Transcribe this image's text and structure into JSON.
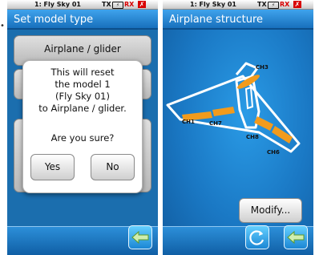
{
  "status": {
    "model": "1: Fly Sky 01",
    "tx_label": "TX",
    "rx_label": "RX"
  },
  "screen1": {
    "title": "Set model type",
    "list_item_1": "Airplane / glider",
    "dialog": {
      "lines": [
        "This will reset",
        "the model 1",
        "(Fly Sky 01)",
        "to Airplane / glider."
      ],
      "question": "Are you sure?",
      "yes_label": "Yes",
      "no_label": "No"
    }
  },
  "screen2": {
    "title": "Airplane structure",
    "channels": [
      "CH3",
      "CH1",
      "CH7",
      "CH8",
      "CH6"
    ],
    "modify_label": "Modify..."
  },
  "colors": {
    "background_blue": "#1f7ec6",
    "surface_orange": "#f29b1d",
    "rx_red": "#d80000"
  },
  "icons": {
    "back": "back-arrow-icon",
    "rotate": "rotate-icon"
  }
}
